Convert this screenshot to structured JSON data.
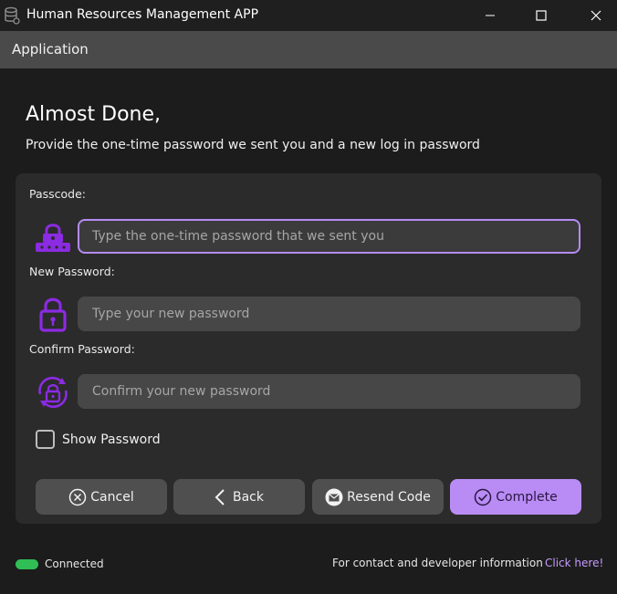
{
  "window": {
    "title": "Human Resources Management APP",
    "icons": {
      "app": "database-icon",
      "minimize": "minimize-icon",
      "maximize": "maximize-icon",
      "close": "close-icon"
    }
  },
  "appbar": {
    "title": "Application"
  },
  "page": {
    "heading": "Almost Done,",
    "subheading": "Provide the one-time password we sent you and a new log in password"
  },
  "form": {
    "passcode": {
      "label": "Passcode:",
      "placeholder": "Type the one-time password that we sent you",
      "icon": "passcode-lock-icon"
    },
    "new_password": {
      "label": "New Password:",
      "placeholder": "Type your new password",
      "icon": "padlock-icon"
    },
    "confirm_password": {
      "label": "Confirm Password:",
      "placeholder": "Confirm your new password",
      "icon": "lock-refresh-icon"
    },
    "show_password": {
      "label": "Show Password",
      "checked": false
    }
  },
  "buttons": {
    "cancel": {
      "label": "Cancel",
      "icon": "close-circle-icon"
    },
    "back": {
      "label": "Back",
      "icon": "chevron-left-icon"
    },
    "resend": {
      "label": "Resend Code",
      "icon": "mail-icon"
    },
    "complete": {
      "label": "Complete",
      "icon": "check-circle-icon"
    }
  },
  "status": {
    "connection": "Connected",
    "contact_text": "For contact and developer information",
    "contact_link": "Click here!"
  },
  "colors": {
    "accent": "#b98cf5",
    "icon_purple": "#8b2be2",
    "connected": "#2fbf55",
    "link": "#c79bff"
  }
}
